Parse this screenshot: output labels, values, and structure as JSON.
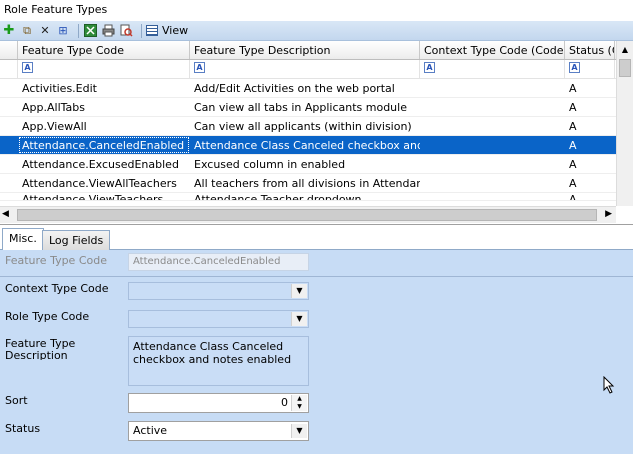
{
  "window": {
    "title": "Role Feature Types"
  },
  "toolbar": {
    "icons": [
      "add-icon",
      "copy-icon",
      "delete-icon",
      "grid-icon",
      "excel-icon",
      "print-icon",
      "preview-icon"
    ],
    "view_label": "View"
  },
  "grid": {
    "columns": [
      "Feature Type Code",
      "Feature Type Description",
      "Context Type Code (Code)",
      "Status (C"
    ],
    "filter_glyph": "A",
    "rows": [
      {
        "code": "Activities.Edit",
        "desc": " Add/Edit Activities on the web portal",
        "status": "A"
      },
      {
        "code": "App.AllTabs",
        "desc": "Can view all tabs in Applicants module",
        "status": "A"
      },
      {
        "code": "App.ViewAll",
        "desc": "Can view all applicants (within division)",
        "status": "A"
      },
      {
        "code": "Attendance.CanceledEnabled",
        "desc": "Attendance Class Canceled checkbox and not",
        "status": "A",
        "selected": true
      },
      {
        "code": "Attendance.ExcusedEnabled",
        "desc": "Excused column in enabled",
        "status": "A"
      },
      {
        "code": "Attendance.ViewAllTeachers",
        "desc": "All teachers from all divisions in AttendanceBy",
        "status": "A"
      },
      {
        "code": "Attendance.ViewTeachers",
        "desc": "Attendance Teacher dropdown",
        "status": "A"
      }
    ]
  },
  "tabs": [
    {
      "label": "Misc.",
      "active": true
    },
    {
      "label": "Log Fields",
      "active": false
    }
  ],
  "form": {
    "feature_type_code_label": "Feature Type Code",
    "feature_type_code_value": "Attendance.CanceledEnabled",
    "context_type_code_label": "Context Type Code",
    "context_type_code_value": "",
    "role_type_code_label": "Role Type Code",
    "role_type_code_value": "",
    "feature_type_description_label": "Feature Type Description",
    "feature_type_description_value": "Attendance Class Canceled checkbox and notes enabled",
    "sort_label": "Sort",
    "sort_value": "0",
    "status_label": "Status",
    "status_value": "Active"
  }
}
